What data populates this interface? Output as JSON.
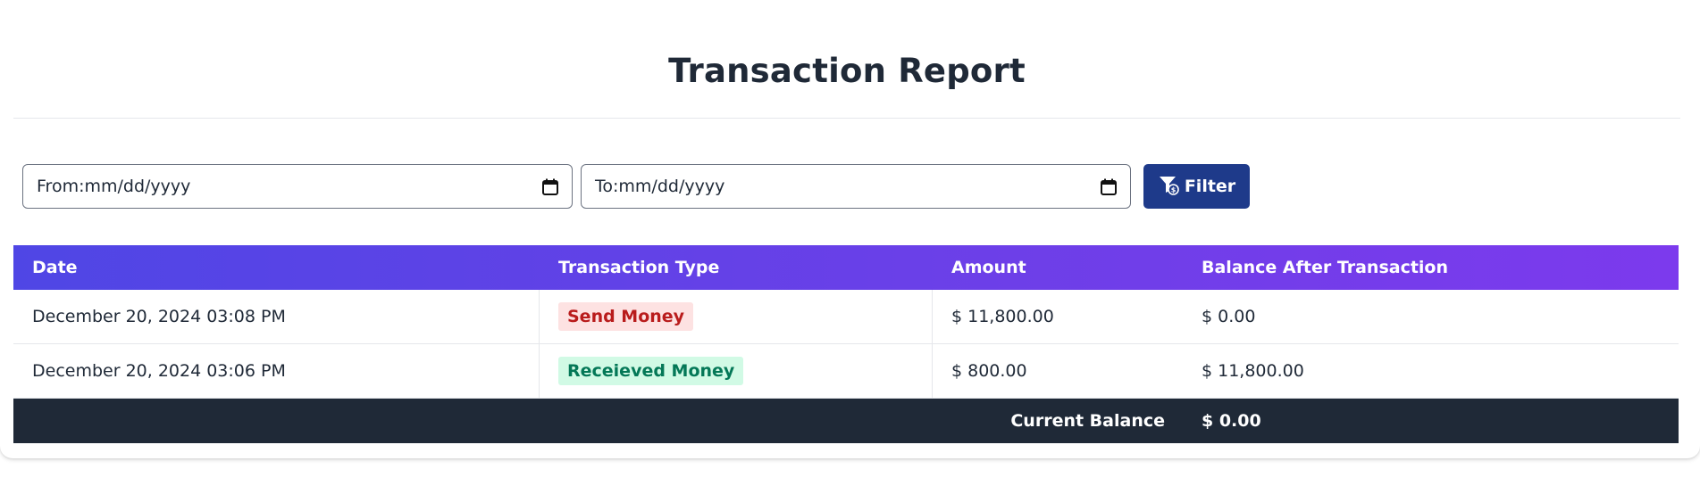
{
  "page": {
    "title": "Transaction Report"
  },
  "filters": {
    "from_label": "From:mm/dd/yyyy",
    "to_label": "To:mm/dd/yyyy",
    "filter_button": "Filter"
  },
  "table": {
    "headers": [
      "Date",
      "Transaction Type",
      "Amount",
      "Balance After Transaction"
    ],
    "rows": [
      {
        "date": "December 20, 2024 03:08 PM",
        "type": "Send Money",
        "type_kind": "send",
        "amount": "$ 11,800.00",
        "balance": "$ 0.00"
      },
      {
        "date": "December 20, 2024 03:06 PM",
        "type": "Receieved Money",
        "type_kind": "received",
        "amount": "$ 800.00",
        "balance": "$ 11,800.00"
      }
    ],
    "footer": {
      "label": "Current Balance",
      "value": "$ 0.00"
    }
  },
  "colors": {
    "header_gradient_start": "#4f46e5",
    "header_gradient_end": "#7c3aed",
    "filter_button": "#1e3a8a",
    "footer_bg": "#1f2937",
    "send_badge_bg": "#fde2e2",
    "send_badge_text": "#b91c1c",
    "received_badge_bg": "#d1fae5",
    "received_badge_text": "#047857"
  },
  "icons": {
    "date_picker": "calendar-icon",
    "filter": "filter-dollar-icon"
  }
}
